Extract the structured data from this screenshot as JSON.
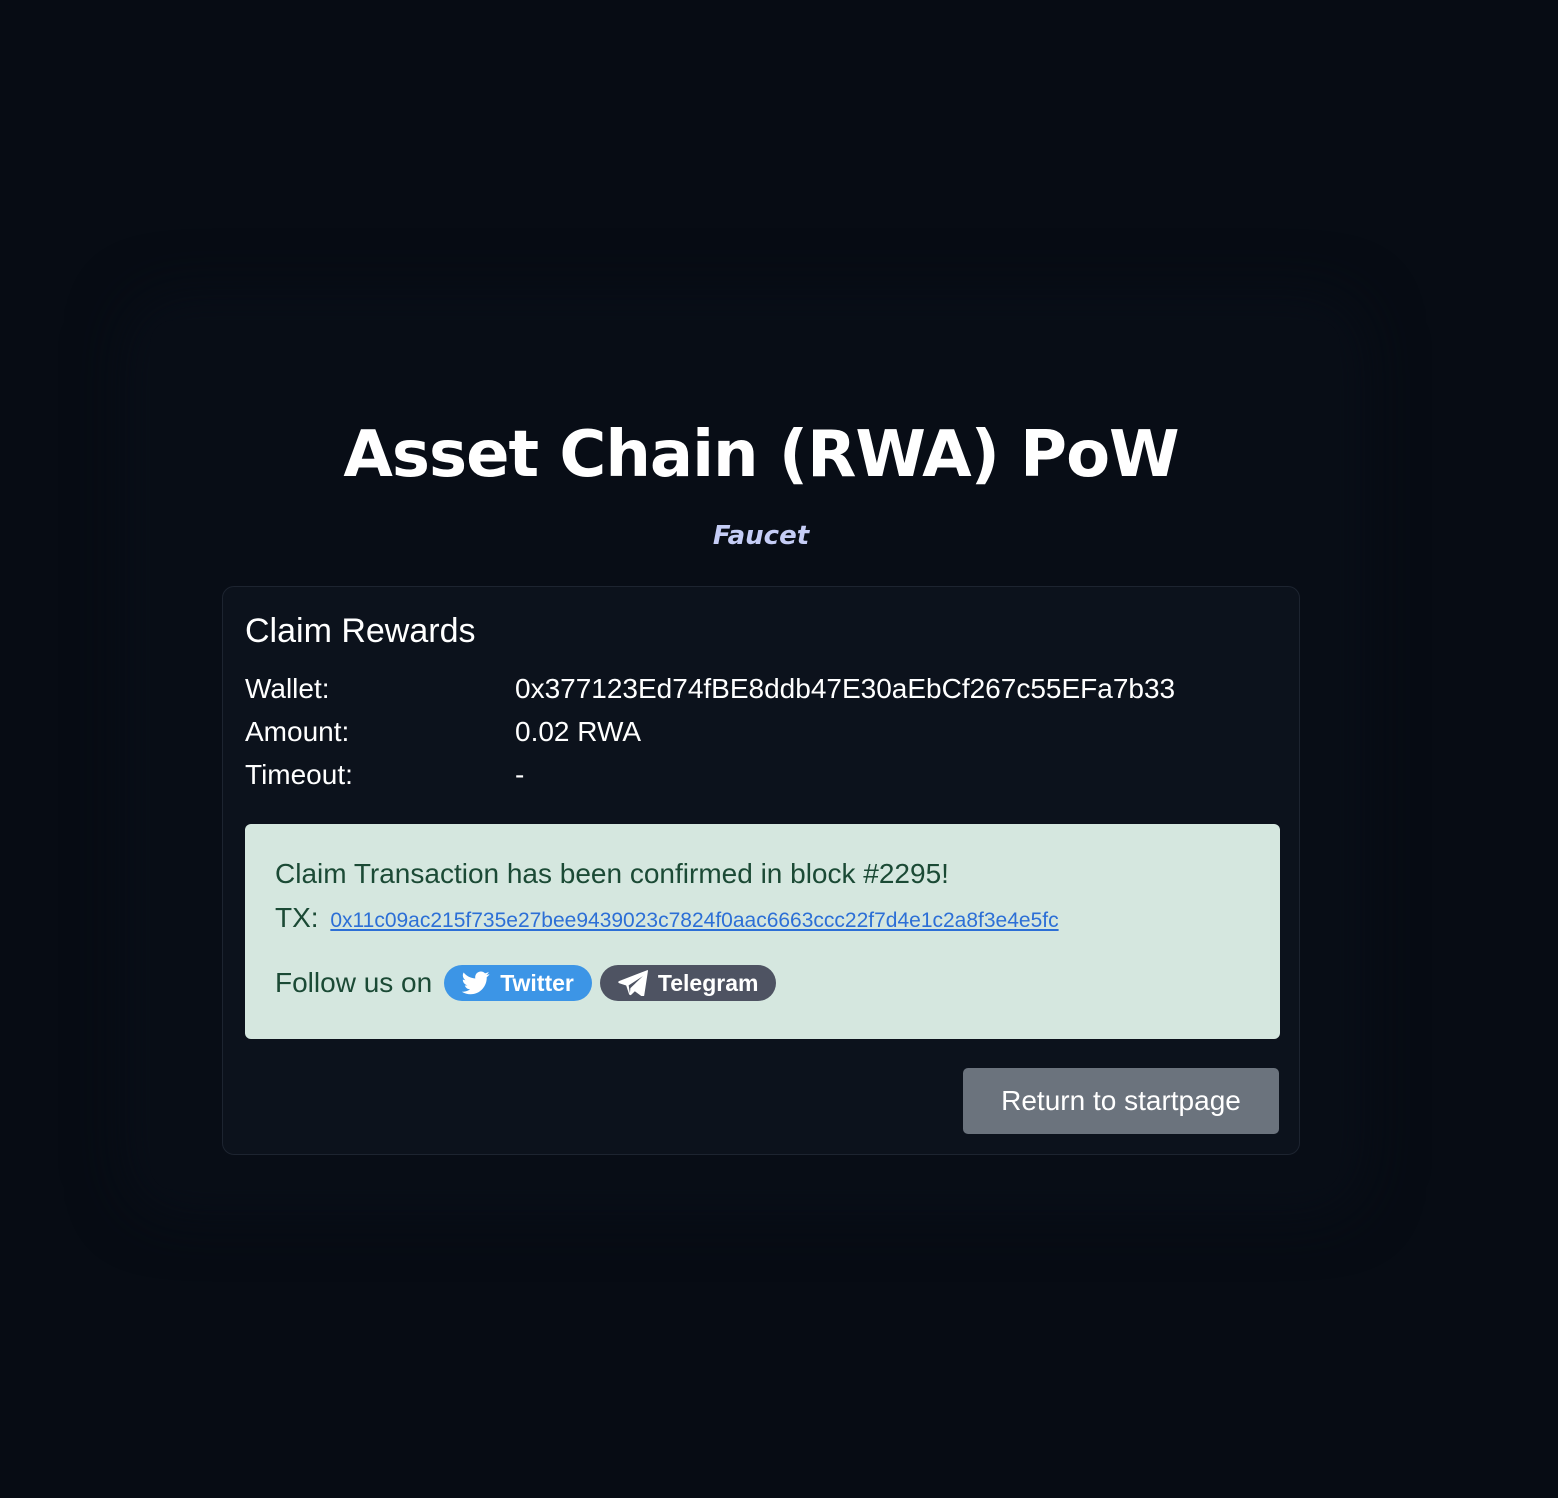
{
  "header": {
    "title": "Asset Chain (RWA) PoW",
    "subtitle": "Faucet"
  },
  "card": {
    "title": "Claim Rewards",
    "rows": [
      {
        "label": "Wallet:",
        "value": "0x377123Ed74fBE8ddb47E30aEbCf267c55EFa7b33"
      },
      {
        "label": "Amount:",
        "value": "0.02 RWA"
      },
      {
        "label": "Timeout:",
        "value": "-"
      }
    ],
    "alert": {
      "message": "Claim Transaction has been confirmed in block #2295!",
      "tx_label": "TX:",
      "tx_hash": "0x11c09ac215f735e27bee9439023c7824f0aac6663ccc22f7d4e1c2a8f3e4e5fc",
      "follow_label": "Follow us on",
      "twitter_label": "Twitter",
      "telegram_label": "Telegram"
    },
    "return_button": "Return to startpage"
  },
  "colors": {
    "background": "#070c14",
    "card": "#0c121c",
    "alert_bg": "#d5e7df",
    "alert_text": "#1b4a35",
    "link": "#2c6fd6",
    "twitter": "#3c95e6",
    "telegram": "#4e5362",
    "button": "#6b737d",
    "subtitle": "#c5cdf6"
  },
  "icons": {
    "twitter": "twitter-bird-icon",
    "telegram": "telegram-plane-icon"
  }
}
